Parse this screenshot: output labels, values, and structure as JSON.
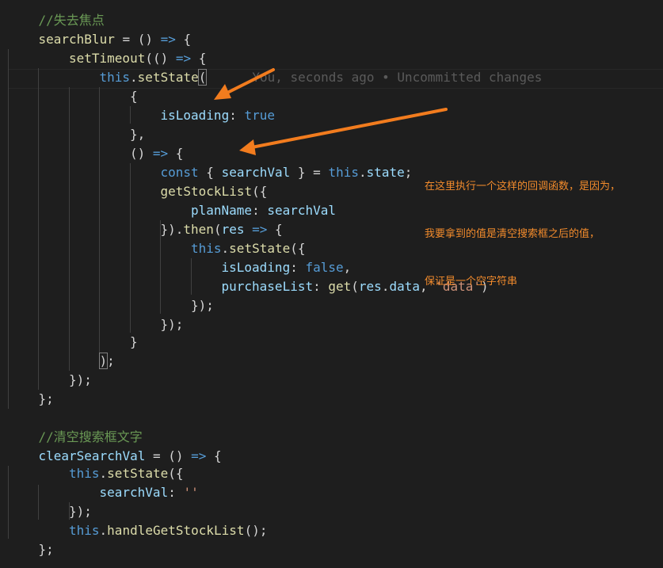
{
  "colors": {
    "background": "#1e1e1e",
    "comment": "#6a9955",
    "function": "#dcdcaa",
    "keyword": "#569cd6",
    "variable": "#9cdcfe",
    "string": "#ce9178",
    "punctuation": "#d4d4d4",
    "blame": "#5a5a5a",
    "annotation": "#f28b2c"
  },
  "code_lines": [
    {
      "id": "comment-blur",
      "tokens": [
        [
          "comment",
          "//失去焦点"
        ]
      ]
    },
    {
      "id": "searchblur-decl",
      "tokens": [
        [
          "function",
          "searchBlur"
        ],
        [
          "punct",
          " = () "
        ],
        [
          "keyword",
          "=>"
        ],
        [
          "punct",
          " {"
        ]
      ]
    },
    {
      "id": "settimeout",
      "tokens": [
        [
          "function",
          "setTimeout"
        ],
        [
          "punct",
          "(() "
        ],
        [
          "keyword",
          "=>"
        ],
        [
          "punct",
          " {"
        ]
      ]
    },
    {
      "id": "setstate-1",
      "tokens": [
        [
          "keyword",
          "this"
        ],
        [
          "punct",
          "."
        ],
        [
          "function",
          "setState"
        ],
        [
          "punct",
          "("
        ]
      ],
      "blame": "You, seconds ago • Uncommitted changes"
    },
    {
      "id": "brace-open",
      "tokens": [
        [
          "punct",
          "{"
        ]
      ]
    },
    {
      "id": "isloading-true",
      "tokens": [
        [
          "variable",
          "isLoading"
        ],
        [
          "punct",
          ": "
        ],
        [
          "keyword",
          "true"
        ]
      ]
    },
    {
      "id": "brace-close",
      "tokens": [
        [
          "punct",
          "},"
        ]
      ]
    },
    {
      "id": "callback-decl",
      "tokens": [
        [
          "punct",
          "() "
        ],
        [
          "keyword",
          "=>"
        ],
        [
          "punct",
          " {"
        ]
      ]
    },
    {
      "id": "const-destructure",
      "tokens": [
        [
          "keyword",
          "const"
        ],
        [
          "punct",
          " { "
        ],
        [
          "variable",
          "searchVal"
        ],
        [
          "punct",
          " } = "
        ],
        [
          "keyword",
          "this"
        ],
        [
          "punct",
          "."
        ],
        [
          "variable",
          "state"
        ],
        [
          "punct",
          ";"
        ]
      ]
    },
    {
      "id": "getstocklist",
      "tokens": [
        [
          "function",
          "getStockList"
        ],
        [
          "punct",
          "({"
        ]
      ]
    },
    {
      "id": "planname",
      "tokens": [
        [
          "variable",
          "planName"
        ],
        [
          "punct",
          ": "
        ],
        [
          "variable",
          "searchVal"
        ]
      ]
    },
    {
      "id": "then",
      "tokens": [
        [
          "punct",
          "})."
        ],
        [
          "function",
          "then"
        ],
        [
          "punct",
          "("
        ],
        [
          "variable",
          "res"
        ],
        [
          "punct",
          " "
        ],
        [
          "keyword",
          "=>"
        ],
        [
          "punct",
          " {"
        ]
      ]
    },
    {
      "id": "setstate-2",
      "tokens": [
        [
          "keyword",
          "this"
        ],
        [
          "punct",
          "."
        ],
        [
          "function",
          "setState"
        ],
        [
          "punct",
          "({"
        ]
      ]
    },
    {
      "id": "isloading-false",
      "tokens": [
        [
          "variable",
          "isLoading"
        ],
        [
          "punct",
          ": "
        ],
        [
          "keyword",
          "false"
        ],
        [
          "punct",
          ","
        ]
      ]
    },
    {
      "id": "purchaselist",
      "tokens": [
        [
          "variable",
          "purchaseList"
        ],
        [
          "punct",
          ": "
        ],
        [
          "function",
          "get"
        ],
        [
          "punct",
          "("
        ],
        [
          "variable",
          "res"
        ],
        [
          "punct",
          "."
        ],
        [
          "variable",
          "data"
        ],
        [
          "punct",
          ", "
        ],
        [
          "string",
          "'data'"
        ],
        [
          "punct",
          ")"
        ]
      ]
    },
    {
      "id": "close-setstate-2",
      "tokens": [
        [
          "punct",
          "});"
        ]
      ]
    },
    {
      "id": "close-then",
      "tokens": [
        [
          "punct",
          "});"
        ]
      ]
    },
    {
      "id": "close-callback",
      "tokens": [
        [
          "punct",
          "}"
        ]
      ]
    },
    {
      "id": "close-setstate-1",
      "tokens": [
        [
          "punct",
          ")"
        ],
        [
          "punct",
          ";"
        ]
      ]
    },
    {
      "id": "close-settimeout",
      "tokens": [
        [
          "punct",
          "});"
        ]
      ]
    },
    {
      "id": "close-searchblur",
      "tokens": [
        [
          "punct",
          "};"
        ]
      ]
    },
    {
      "id": "blank",
      "tokens": []
    },
    {
      "id": "comment-clear",
      "tokens": [
        [
          "comment",
          "//清空搜索框文字"
        ]
      ]
    },
    {
      "id": "clearsearchval-decl",
      "tokens": [
        [
          "variable",
          "clearSearchVal"
        ],
        [
          "punct",
          " = () "
        ],
        [
          "keyword",
          "=>"
        ],
        [
          "punct",
          " {"
        ]
      ]
    },
    {
      "id": "setstate-3",
      "tokens": [
        [
          "keyword",
          "this"
        ],
        [
          "punct",
          "."
        ],
        [
          "function",
          "setState"
        ],
        [
          "punct",
          "({"
        ]
      ]
    },
    {
      "id": "searchval-empty",
      "tokens": [
        [
          "variable",
          "searchVal"
        ],
        [
          "punct",
          ": "
        ],
        [
          "string",
          "''"
        ]
      ]
    },
    {
      "id": "close-setstate-3",
      "tokens": [
        [
          "punct",
          "});"
        ]
      ]
    },
    {
      "id": "handlegetstocklist",
      "tokens": [
        [
          "keyword",
          "this"
        ],
        [
          "punct",
          "."
        ],
        [
          "function",
          "handleGetStockList"
        ],
        [
          "punct",
          "();"
        ]
      ]
    },
    {
      "id": "close-clearsearchval",
      "tokens": [
        [
          "punct",
          "};"
        ]
      ]
    }
  ],
  "annotation": {
    "lines": [
      "在这里执行一个这样的回调函数，是因为，",
      "我要拿到的值是清空搜索框之后的值，",
      "保证是一个空字符串"
    ]
  }
}
